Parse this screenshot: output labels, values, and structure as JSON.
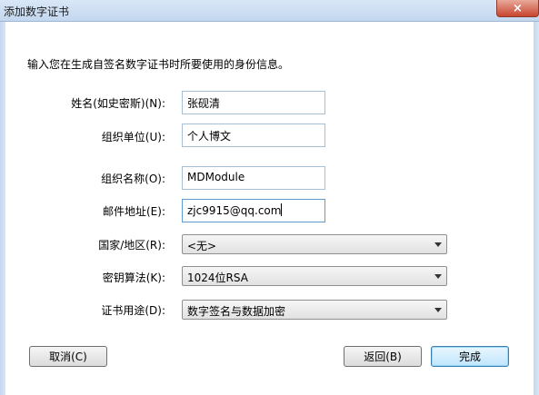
{
  "window": {
    "title": "添加数字证书",
    "close_glyph": "×"
  },
  "instruction": "输入您在生成自签名数字证书时所要使用的身份信息。",
  "fields": {
    "name": {
      "label": "姓名(如史密斯)(N):",
      "value": "张砚清"
    },
    "org_unit": {
      "label": "组织单位(U):",
      "value": "个人博文"
    },
    "org_name": {
      "label": "组织名称(O):",
      "value": "MDModule"
    },
    "email": {
      "label": "邮件地址(E):",
      "value": "zjc9915@qq.com"
    }
  },
  "selects": {
    "country": {
      "label": "国家/地区(R):",
      "value": "<无>"
    },
    "algorithm": {
      "label": "密钥算法(K):",
      "value": "1024位RSA"
    },
    "usage": {
      "label": "证书用途(D):",
      "value": "数字签名与数据加密"
    }
  },
  "buttons": {
    "cancel": "取消(C)",
    "back": "返回(B)",
    "finish": "完成"
  },
  "icons": {
    "close": "close-icon",
    "dropdown": "chevron-down-icon"
  }
}
